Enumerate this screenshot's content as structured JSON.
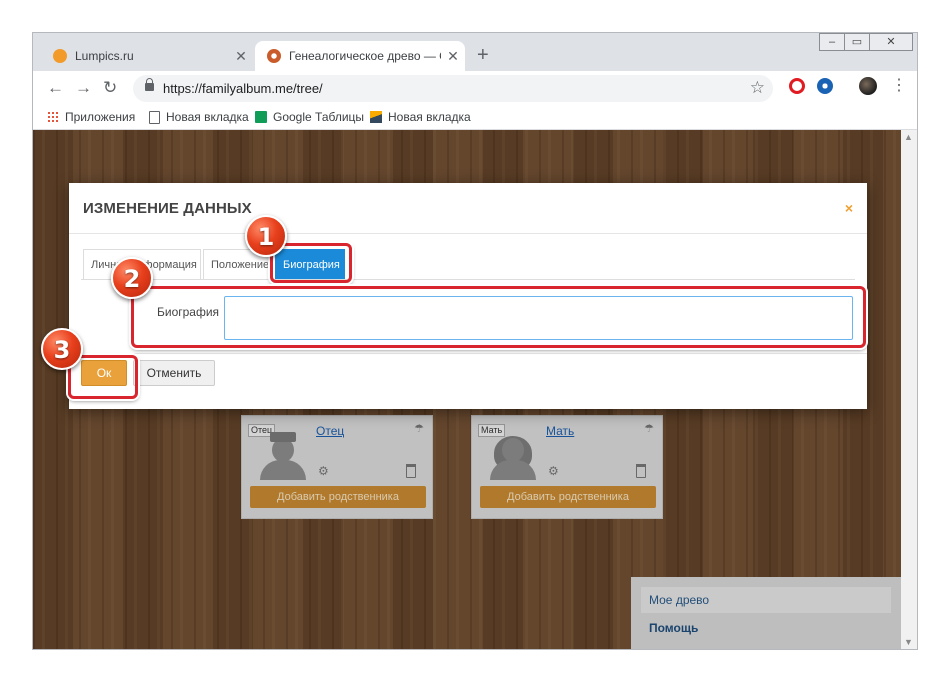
{
  "browser": {
    "tabs": [
      {
        "title": "Lumpics.ru",
        "active": false
      },
      {
        "title": "Генеалогическое древо — Сем",
        "active": true
      }
    ],
    "new_tab_label": "+",
    "address": "https://familyalbum.me/tree/",
    "bookmarks": [
      {
        "label": "Приложения",
        "icon": "apps-icon"
      },
      {
        "label": "Новая вкладка",
        "icon": "page-icon"
      },
      {
        "label": "Google Таблицы",
        "icon": "sheets-icon"
      },
      {
        "label": "Новая вкладка",
        "icon": "image-icon"
      }
    ]
  },
  "modal": {
    "title": "ИЗМЕНЕНИЕ ДАННЫХ",
    "close_label": "×",
    "tabs": [
      {
        "label": "Личная информация"
      },
      {
        "label": "Положение"
      },
      {
        "label": "Биография",
        "active": true
      }
    ],
    "field_label": "Биография",
    "field_value": "",
    "ok_label": "Ок",
    "cancel_label": "Отменить"
  },
  "tree": {
    "cards": [
      {
        "role": "Отец",
        "name": "Отец",
        "add_label": "Добавить родственника"
      },
      {
        "role": "Мать",
        "name": "Мать",
        "add_label": "Добавить родственника"
      }
    ]
  },
  "side_menu": [
    {
      "label": "Мое древо"
    },
    {
      "label": "Помощь"
    }
  ],
  "annotations": [
    {
      "number": "1"
    },
    {
      "number": "2"
    },
    {
      "number": "3"
    }
  ],
  "colors": {
    "accent_blue": "#1b8ad8",
    "ok_orange": "#e9a23b",
    "highlight_red": "#d9262e",
    "link_blue": "#1c5fb0"
  }
}
